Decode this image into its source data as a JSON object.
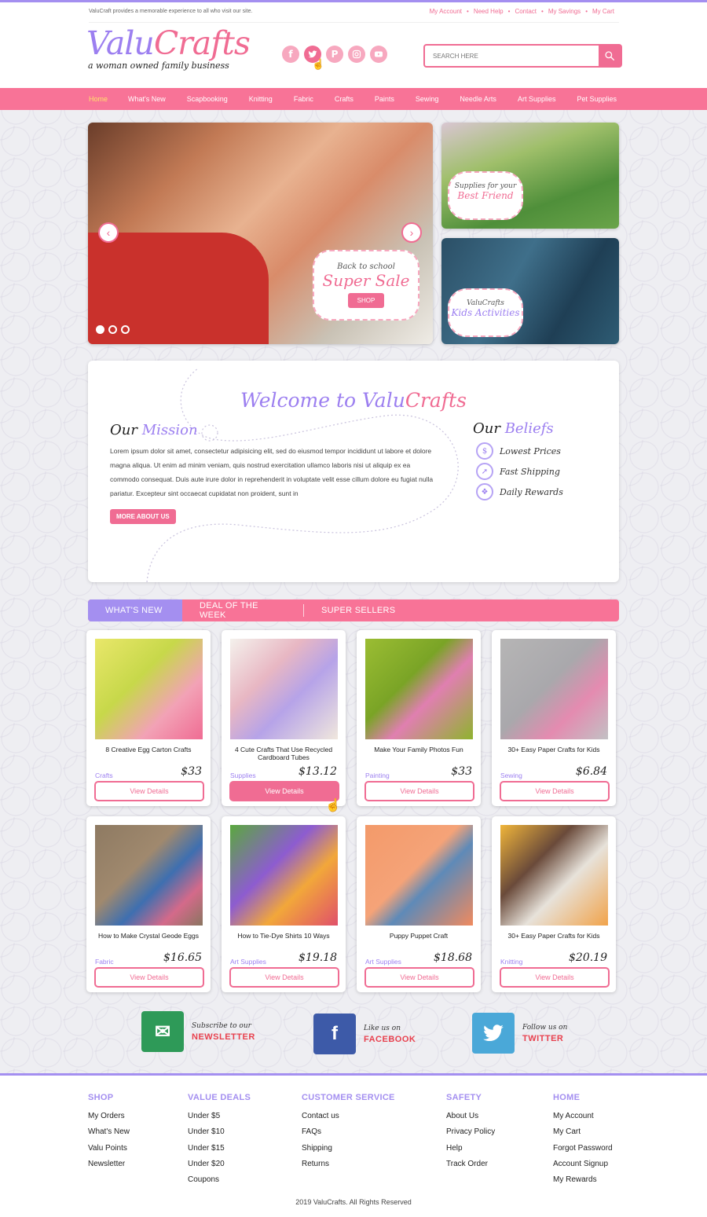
{
  "header": {
    "tagline": "ValuCraft provides a memorable experience to all who visit our site.",
    "top_links": [
      "My Account",
      "Need Help",
      "Contact",
      "My Savings",
      "My Cart"
    ],
    "logo_part1": "Valu",
    "logo_part2": "Crafts",
    "logo_sub": "a woman owned family business",
    "social_icons": [
      "facebook-icon",
      "twitter-icon",
      "pinterest-icon",
      "instagram-icon",
      "youtube-icon"
    ],
    "search_placeholder": "SEARCH HERE"
  },
  "nav": [
    "Home",
    "What's New",
    "Scapbooking",
    "Knitting",
    "Fabric",
    "Crafts",
    "Paints",
    "Sewing",
    "Needle Arts",
    "Art Supplies",
    "Pet Supplies"
  ],
  "hero": {
    "line1": "Back to school",
    "line2": "Super Sale",
    "button": "SHOP"
  },
  "side1": {
    "line1": "Supplies for your",
    "line2": "Best Friend"
  },
  "side2": {
    "line1": "ValuCrafts",
    "line2": "Kids Activities"
  },
  "welcome": {
    "title_a": "Welcome to Valu",
    "title_b": "Crafts",
    "mission_a": "Our",
    "mission_b": "Mission",
    "mission_text": "Lorem ipsum dolor sit amet, consectetur adipisicing elit, sed do eiusmod tempor incididunt ut labore et dolore magna aliqua. Ut enim ad minim veniam, quis nostrud exercitation ullamco laboris nisi ut aliquip ex ea commodo consequat. Duis aute irure dolor in reprehenderit in voluptate velit esse cillum dolore eu fugiat nulla pariatur. Excepteur sint occaecat cupidatat non proident, sunt in",
    "more_button": "MORE ABOUT US",
    "beliefs_a": "Our",
    "beliefs_b": "Beliefs",
    "beliefs": [
      "Lowest Prices",
      "Fast Shipping",
      "Daily Rewards"
    ]
  },
  "tabs": [
    "WHAT'S NEW",
    "DEAL OF THE WEEK",
    "SUPER SELLERS"
  ],
  "products": [
    {
      "title": "8 Creative Egg Carton Crafts",
      "category": "Crafts",
      "price": "$33",
      "button": "View Details"
    },
    {
      "title": "4 Cute Crafts That Use Recycled Cardboard Tubes",
      "category": "Supplies",
      "price": "$13.12",
      "button": "View Details"
    },
    {
      "title": "Make Your Family Photos Fun",
      "category": "Painting",
      "price": "$33",
      "button": "View Details"
    },
    {
      "title": "30+ Easy Paper Crafts for Kids",
      "category": "Sewing",
      "price": "$6.84",
      "button": "View Details"
    },
    {
      "title": "How to Make Crystal Geode Eggs",
      "category": "Fabric",
      "price": "$16.65",
      "button": "View Details"
    },
    {
      "title": "How to Tie-Dye Shirts 10 Ways",
      "category": "Art Supplies",
      "price": "$19.18",
      "button": "View Details"
    },
    {
      "title": "Puppy Puppet Craft",
      "category": "Art Supplies",
      "price": "$18.68",
      "button": "View Details"
    },
    {
      "title": "30+ Easy Paper Crafts for Kids",
      "category": "Knitting",
      "price": "$20.19",
      "button": "View Details"
    }
  ],
  "social_row": [
    {
      "line1": "Subscribe to our",
      "line2": "NEWSLETTER"
    },
    {
      "line1": "Like us on",
      "line2": "FACEBOOK"
    },
    {
      "line1": "Follow us on",
      "line2": "TWITTER"
    }
  ],
  "footer": {
    "columns": [
      {
        "heading": "SHOP",
        "items": [
          "My Orders",
          "What's New",
          "Valu Points",
          "Newsletter"
        ]
      },
      {
        "heading": "VALUE DEALS",
        "items": [
          "Under $5",
          "Under $10",
          "Under $15",
          "Under $20",
          "Coupons"
        ]
      },
      {
        "heading": "CUSTOMER SERVICE",
        "items": [
          "Contact us",
          "FAQs",
          "Shipping",
          "Returns"
        ]
      },
      {
        "heading": "SAFETY",
        "items": [
          "About Us",
          "Privacy Policy",
          "Help",
          "Track Order"
        ]
      },
      {
        "heading": "HOME",
        "items": [
          "My Account",
          "My Cart",
          "Forgot Password",
          "Account Signup",
          "My Rewards"
        ]
      }
    ],
    "copyright": "2019 ValuCrafts. All Rights Reserved"
  },
  "colors": {
    "pink": "#f06c93",
    "purple": "#9c7ff0",
    "nav": "#f87397"
  }
}
